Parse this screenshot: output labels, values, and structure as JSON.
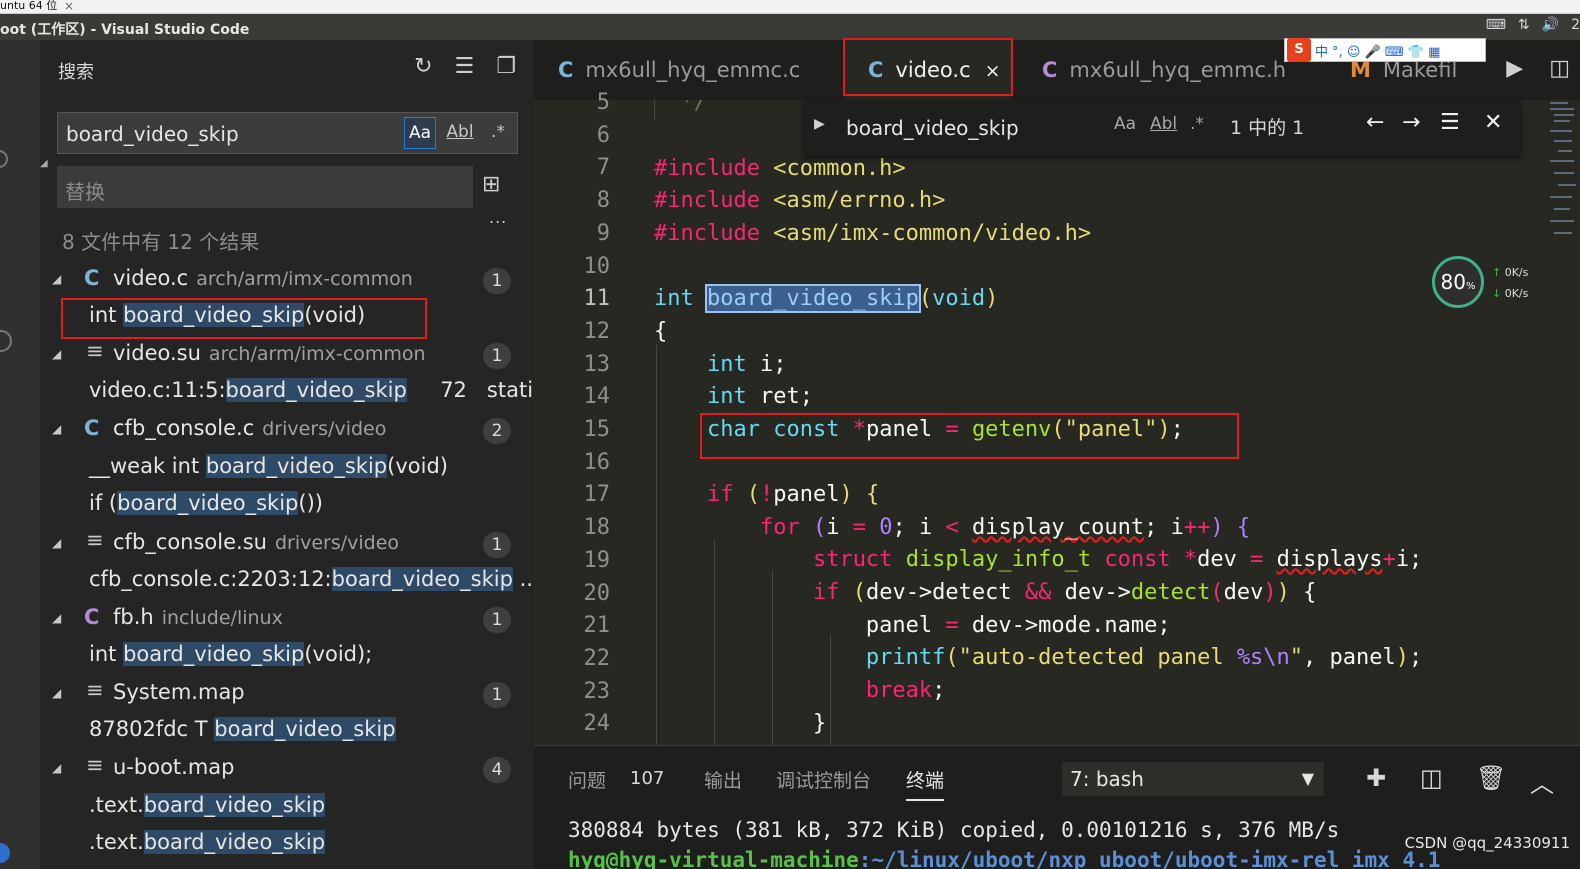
{
  "window": {
    "vm_tab": "untu 64 位",
    "title": "oot (工作区) - Visual Studio Code"
  },
  "sidebar": {
    "title": "搜索",
    "search_value": "board_video_skip",
    "opt_case": "Aa",
    "opt_word": "Abl",
    "opt_regex": ".*",
    "replace_placeholder": "替换",
    "more": "...",
    "summary": "8 文件中有 12 个结果",
    "results": [
      {
        "file": "video.c",
        "path": "arch/arm/imx-common",
        "count": "1",
        "icon": "C"
      },
      {
        "line_pre": "int ",
        "match": "board_video_skip",
        "line_post": "(void)"
      },
      {
        "file": "video.su",
        "path": "arch/arm/imx-common",
        "count": "1",
        "icon": "≡"
      },
      {
        "line_pre": "video.c:11:5:",
        "match": "board_video_skip",
        "line_post": "     72   static"
      },
      {
        "file": "cfb_console.c",
        "path": "drivers/video",
        "count": "2",
        "icon": "C"
      },
      {
        "line_pre": "__weak int ",
        "match": "board_video_skip",
        "line_post": "(void)"
      },
      {
        "line_pre": "if (",
        "match": "board_video_skip",
        "line_post": "())"
      },
      {
        "file": "cfb_console.su",
        "path": "drivers/video",
        "count": "1",
        "icon": "≡"
      },
      {
        "line_pre": "cfb_console.c:2203:12:",
        "match": "board_video_skip",
        "line_post": " ..."
      },
      {
        "file": "fb.h",
        "path": "include/linux",
        "count": "1",
        "icon": "C"
      },
      {
        "line_pre": "int ",
        "match": "board_video_skip",
        "line_post": "(void);"
      },
      {
        "file": "System.map",
        "path": "",
        "count": "1",
        "icon": "≡"
      },
      {
        "line_pre": "87802fdc T ",
        "match": "board_video_skip",
        "line_post": ""
      },
      {
        "file": "u-boot.map",
        "path": "",
        "count": "4",
        "icon": "≡"
      },
      {
        "line_pre": ".text.",
        "match": "board_video_skip",
        "line_post": ""
      },
      {
        "line_pre": ".text.",
        "match": "board_video_skip",
        "line_post": ""
      }
    ]
  },
  "tabs": [
    {
      "icon": "C",
      "label": "mx6ull_hyq_emmc.c"
    },
    {
      "icon": "C",
      "label": "video.c",
      "close": "×"
    },
    {
      "icon": "C",
      "label": "mx6ull_hyq_emmc.h"
    },
    {
      "icon": "M",
      "label": "Makefil"
    }
  ],
  "ime": {
    "logo": "S",
    "text": "中 °, ☺ 🎤 ⌨ 👕 ▦"
  },
  "find": {
    "value": "board_video_skip",
    "count": "1 中的 1",
    "opt_case": "Aa",
    "opt_word": "Abl",
    "opt_regex": ".*"
  },
  "gutter": [
    "5",
    "6",
    "7",
    "8",
    "9",
    "10",
    "11",
    "12",
    "13",
    "14",
    "15",
    "16",
    "17",
    "18",
    "19",
    "20",
    "21",
    "22",
    "23",
    "24"
  ],
  "overlay": {
    "cpu": "80",
    "up": "0K/s",
    "down": "0K/s"
  },
  "panel": {
    "tabs": [
      "问题",
      "输出",
      "调试控制台",
      "终端"
    ],
    "problem_count": "107",
    "terminal_select": "7: bash",
    "line1": "380884 bytes (381 kB, 372 KiB) copied, 0.00101216 s, 376 MB/s",
    "line2_user": "hyq@hyq-virtual-machine",
    "line2_path": ":~/linux/uboot/nxp_uboot/uboot-imx-rel_imx_4.1",
    "watermark": "CSDN @qq_24330911"
  },
  "colors": {
    "accent": "#2b7bd1",
    "redbox": "#e21c1c",
    "match_bg": "#2f4a66"
  }
}
